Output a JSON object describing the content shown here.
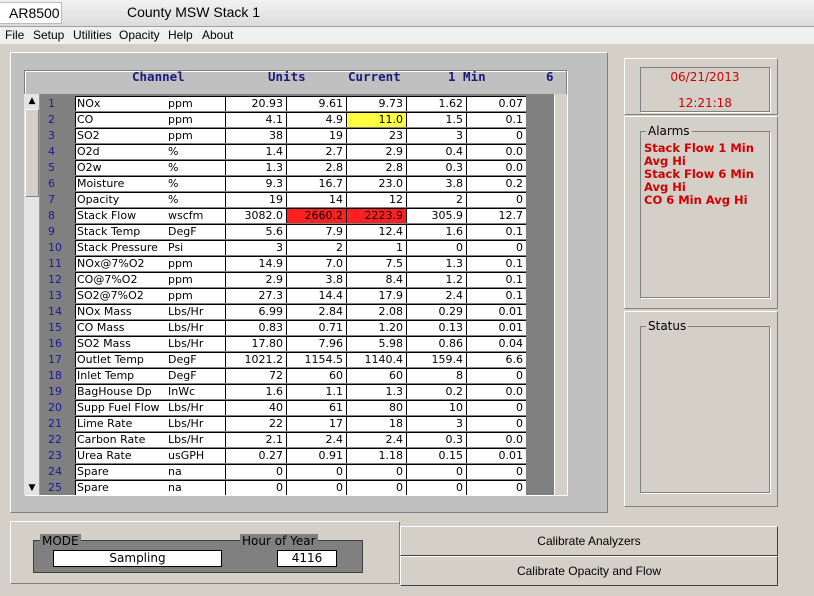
{
  "app_name": "AR8500",
  "window_title": "County MSW Stack 1",
  "menu": [
    "File",
    "Setup",
    "Utilities",
    "Opacity",
    "Help",
    "About"
  ],
  "header": {
    "channel": "Channel",
    "units": "Units",
    "current": "Current",
    "one_min": "1 Min",
    "six": "6"
  },
  "rows": [
    {
      "num": "1",
      "name": "NOx",
      "unit": "ppm",
      "v": [
        "20.93",
        "9.61",
        "9.73",
        "1.62",
        "0.07"
      ]
    },
    {
      "num": "2",
      "name": "CO",
      "unit": "ppm",
      "v": [
        "4.1",
        "4.9",
        "11.0",
        "1.5",
        "0.1"
      ]
    },
    {
      "num": "3",
      "name": "SO2",
      "unit": "ppm",
      "v": [
        "38",
        "19",
        "23",
        "3",
        "0"
      ]
    },
    {
      "num": "4",
      "name": "O2d",
      "unit": "%",
      "v": [
        "1.4",
        "2.7",
        "2.9",
        "0.4",
        "0.0"
      ]
    },
    {
      "num": "5",
      "name": "O2w",
      "unit": "%",
      "v": [
        "1.3",
        "2.8",
        "2.8",
        "0.3",
        "0.0"
      ]
    },
    {
      "num": "6",
      "name": "Moisture",
      "unit": "%",
      "v": [
        "9.3",
        "16.7",
        "23.0",
        "3.8",
        "0.2"
      ]
    },
    {
      "num": "7",
      "name": "Opacity",
      "unit": "%",
      "v": [
        "19",
        "14",
        "12",
        "2",
        "0"
      ]
    },
    {
      "num": "8",
      "name": "Stack Flow",
      "unit": "wscfm",
      "v": [
        "3082.0",
        "2660.2",
        "2223.9",
        "305.9",
        "12.7"
      ]
    },
    {
      "num": "9",
      "name": "Stack Temp",
      "unit": "DegF",
      "v": [
        "5.6",
        "7.9",
        "12.4",
        "1.6",
        "0.1"
      ]
    },
    {
      "num": "10",
      "name": "Stack Pressure",
      "unit": "Psi",
      "v": [
        "3",
        "2",
        "1",
        "0",
        "0"
      ]
    },
    {
      "num": "11",
      "name": "NOx@7%O2",
      "unit": "ppm",
      "v": [
        "14.9",
        "7.0",
        "7.5",
        "1.3",
        "0.1"
      ]
    },
    {
      "num": "12",
      "name": "CO@7%O2",
      "unit": "ppm",
      "v": [
        "2.9",
        "3.8",
        "8.4",
        "1.2",
        "0.1"
      ]
    },
    {
      "num": "13",
      "name": "SO2@7%O2",
      "unit": "ppm",
      "v": [
        "27.3",
        "14.4",
        "17.9",
        "2.4",
        "0.1"
      ]
    },
    {
      "num": "14",
      "name": "NOx Mass",
      "unit": "Lbs/Hr",
      "v": [
        "6.99",
        "2.84",
        "2.08",
        "0.29",
        "0.01"
      ]
    },
    {
      "num": "15",
      "name": "CO Mass",
      "unit": "Lbs/Hr",
      "v": [
        "0.83",
        "0.71",
        "1.20",
        "0.13",
        "0.01"
      ]
    },
    {
      "num": "16",
      "name": "SO2 Mass",
      "unit": "Lbs/Hr",
      "v": [
        "17.80",
        "7.96",
        "5.98",
        "0.86",
        "0.04"
      ]
    },
    {
      "num": "17",
      "name": "Outlet Temp",
      "unit": "DegF",
      "v": [
        "1021.2",
        "1154.5",
        "1140.4",
        "159.4",
        "6.6"
      ]
    },
    {
      "num": "18",
      "name": "Inlet Temp",
      "unit": "DegF",
      "v": [
        "72",
        "60",
        "60",
        "8",
        "0"
      ]
    },
    {
      "num": "19",
      "name": "BagHouse Dp",
      "unit": "InWc",
      "v": [
        "1.6",
        "1.1",
        "1.3",
        "0.2",
        "0.0"
      ]
    },
    {
      "num": "20",
      "name": "Supp Fuel Flow",
      "unit": "Lbs/Hr",
      "v": [
        "40",
        "61",
        "80",
        "10",
        "0"
      ]
    },
    {
      "num": "21",
      "name": "Lime Rate",
      "unit": "Lbs/Hr",
      "v": [
        "22",
        "17",
        "18",
        "3",
        "0"
      ]
    },
    {
      "num": "22",
      "name": "Carbon Rate",
      "unit": "Lbs/Hr",
      "v": [
        "2.1",
        "2.4",
        "2.4",
        "0.3",
        "0.0"
      ]
    },
    {
      "num": "23",
      "name": "Urea Rate",
      "unit": "usGPH",
      "v": [
        "0.27",
        "0.91",
        "1.18",
        "0.15",
        "0.01"
      ]
    },
    {
      "num": "24",
      "name": "Spare",
      "unit": "na",
      "v": [
        "0",
        "0",
        "0",
        "0",
        "0"
      ]
    },
    {
      "num": "25",
      "name": "Spare",
      "unit": "na",
      "v": [
        "0",
        "0",
        "0",
        "0",
        "0"
      ]
    }
  ],
  "highlights": [
    {
      "row": 1,
      "col": 2,
      "color": "#ffff40"
    },
    {
      "row": 7,
      "col": 1,
      "color": "#ff2020"
    },
    {
      "row": 7,
      "col": 2,
      "color": "#ff2020"
    }
  ],
  "date": "06/21/2013",
  "time": "12:21:18",
  "alarms_title": "Alarms",
  "alarms": [
    "Stack Flow  1 Min Avg Hi",
    "Stack Flow  6 Min Avg Hi",
    "CO  6 Min Avg Hi"
  ],
  "status_title": "Status",
  "mode_label": "MODE",
  "mode_value": "Sampling",
  "hour_label": "Hour of Year",
  "hour_value": "4116",
  "btn_calibrate_analyzers": "Calibrate Analyzers",
  "btn_calibrate_opacity": "Calibrate Opacity and Flow",
  "colors": {
    "alarm_text": "#d00000",
    "header_text": "#1a1a7e",
    "grid_bg": "#808080"
  }
}
